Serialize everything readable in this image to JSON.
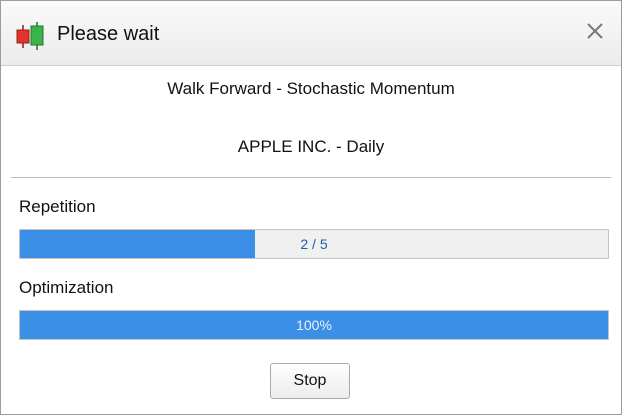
{
  "window": {
    "title": "Please wait",
    "icon": "candlestick-chart-icon",
    "close_icon": "close-icon"
  },
  "header": {
    "line1": "Walk Forward - Stochastic Momentum",
    "line2": "APPLE INC. - Daily"
  },
  "repetition": {
    "label": "Repetition",
    "progress_text": "2 / 5",
    "current": 2,
    "total": 5,
    "fraction": 0.4
  },
  "optimization": {
    "label": "Optimization",
    "progress_text": "100%",
    "percent": 100
  },
  "actions": {
    "stop_label": "Stop"
  },
  "colors": {
    "progress_fill": "#3c8fe6",
    "icon_red": "#e0342b",
    "icon_green": "#3bb34a"
  }
}
